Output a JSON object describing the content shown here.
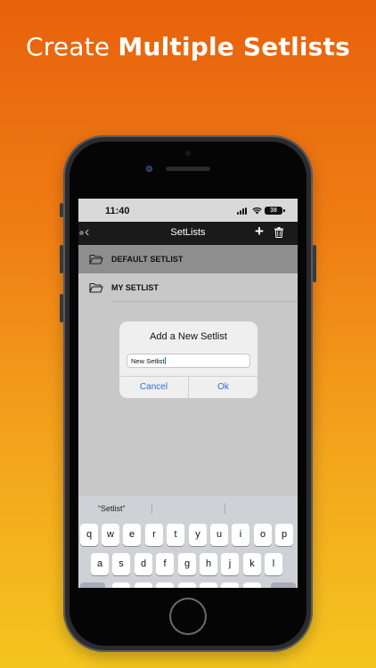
{
  "headline": {
    "prefix": "Create",
    "emphasis": "Multiple Setlists"
  },
  "status_bar": {
    "time": "11:40",
    "battery": "38"
  },
  "nav": {
    "title": "SetLists"
  },
  "setlists": [
    {
      "label": "DEFAULT SETLIST",
      "selected": true
    },
    {
      "label": "MY SETLIST",
      "selected": false
    }
  ],
  "dialog": {
    "title": "Add a New Setlist",
    "input_value": "New Setlist",
    "cancel_label": "Cancel",
    "ok_label": "Ok"
  },
  "keyboard": {
    "suggestion": "“Setlist”",
    "row1": [
      "q",
      "w",
      "e",
      "r",
      "t",
      "y",
      "u",
      "i",
      "o",
      "p"
    ],
    "row2": [
      "a",
      "s",
      "d",
      "f",
      "g",
      "h",
      "j",
      "k",
      "l"
    ]
  },
  "colors": {
    "accent": "#2a6fd6",
    "navbar": "#1a1a1a",
    "selected_row": "#8e8e8e"
  }
}
